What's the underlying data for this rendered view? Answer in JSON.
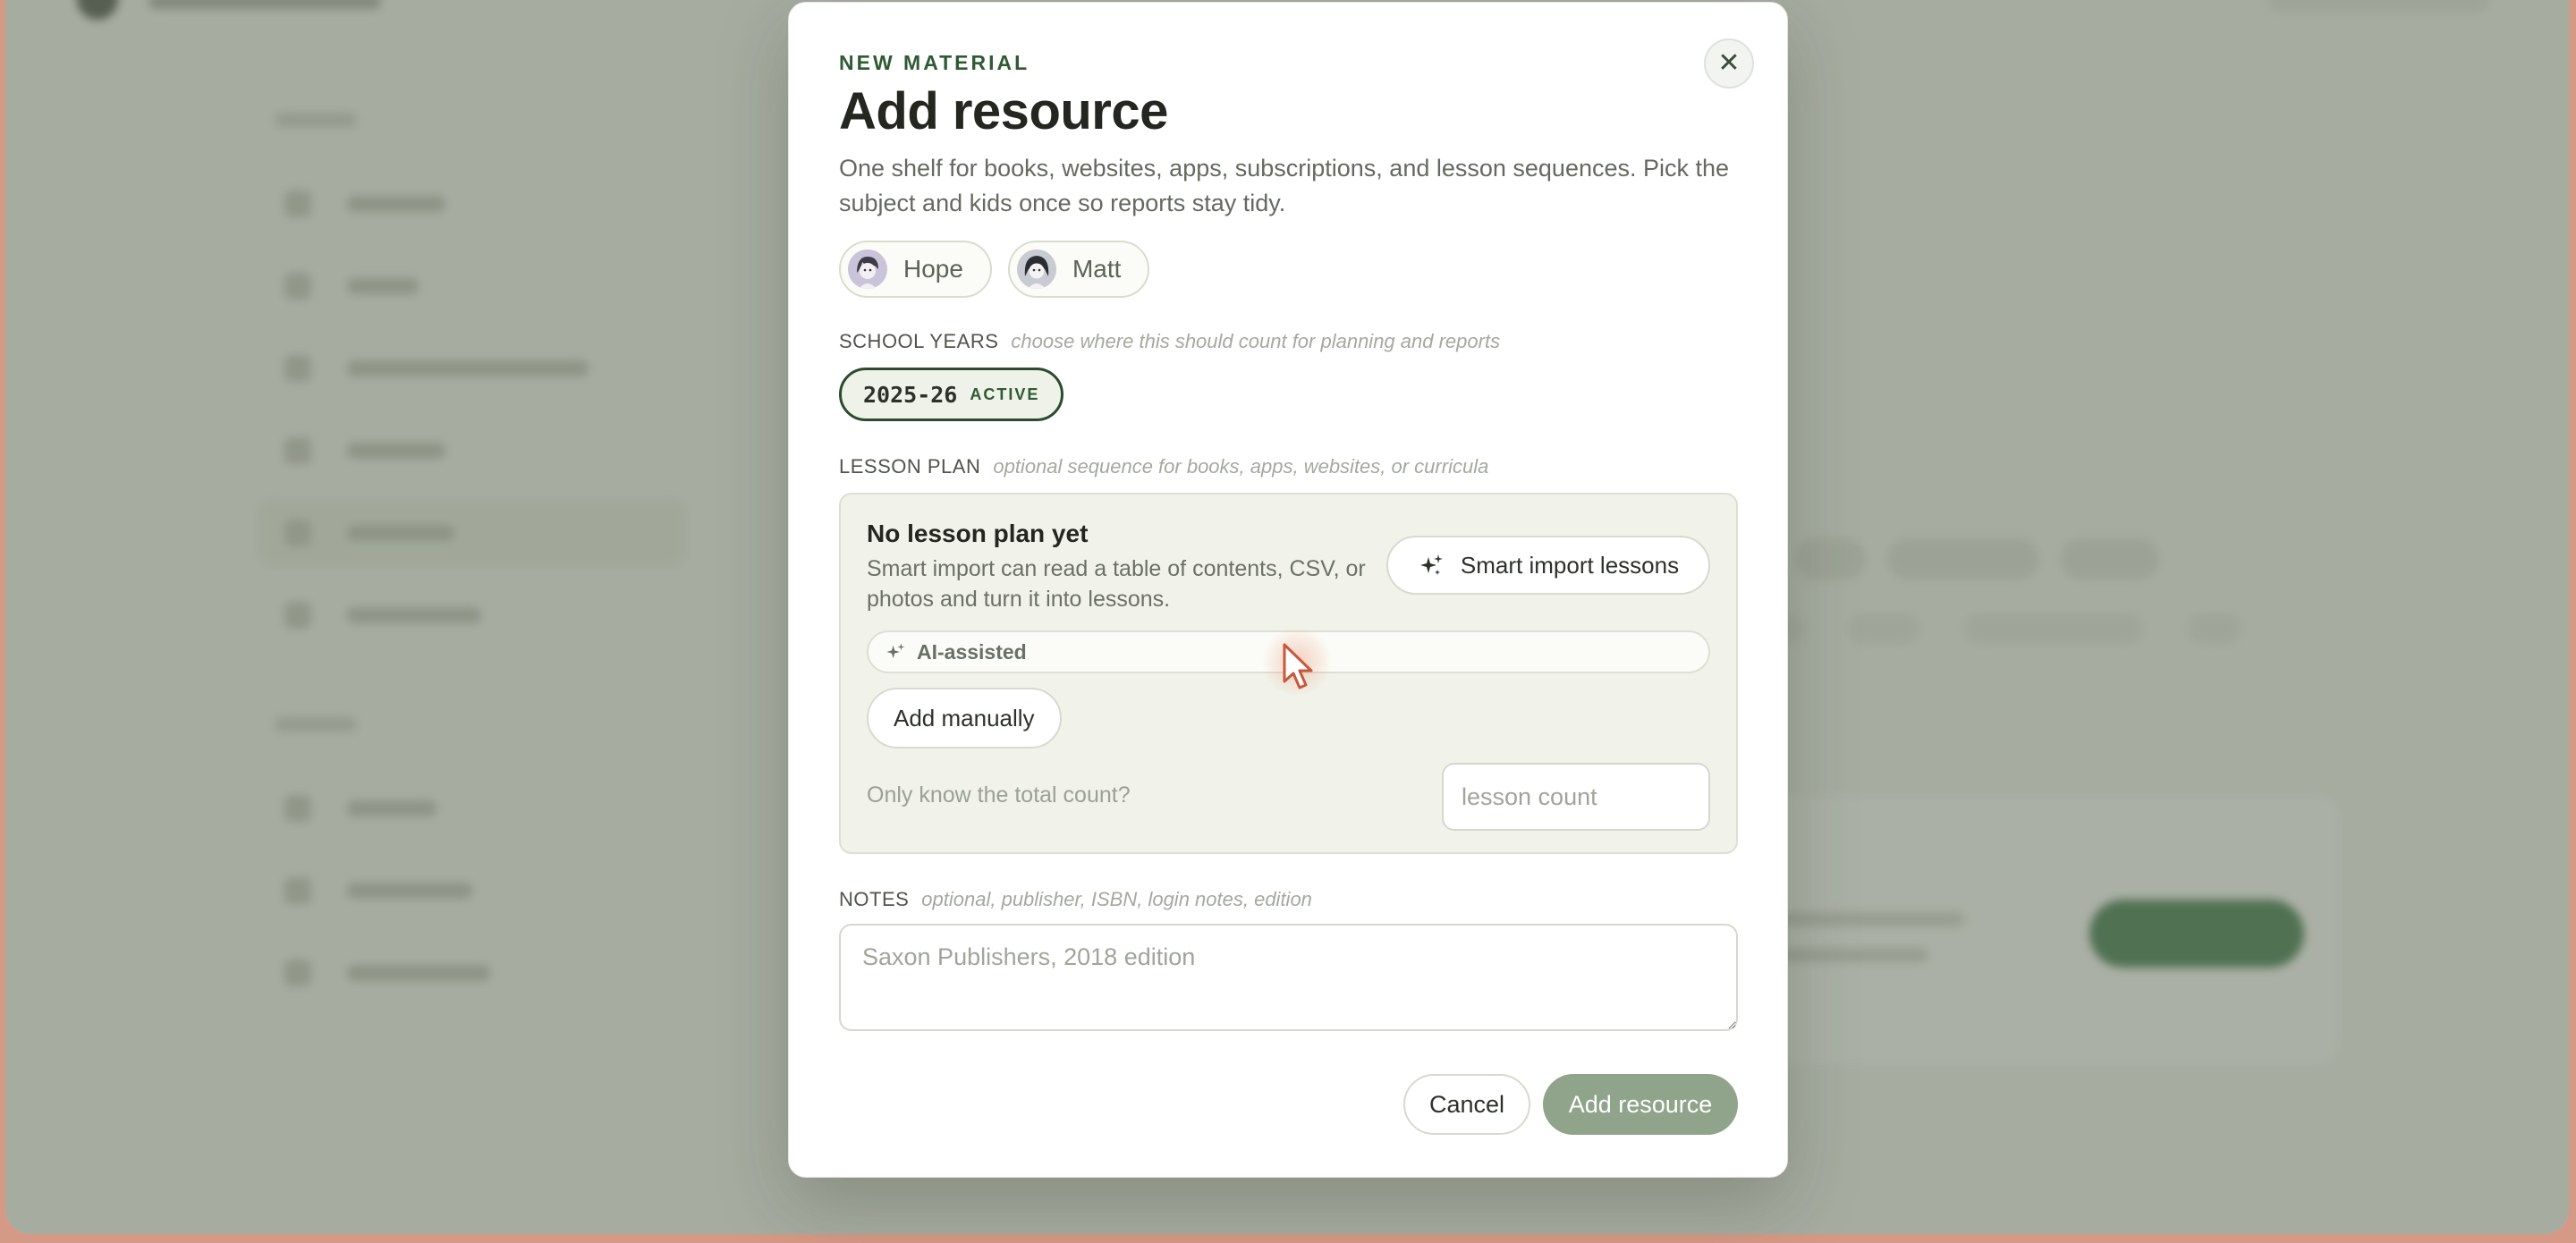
{
  "modal": {
    "eyebrow": "NEW MATERIAL",
    "title": "Add resource",
    "description": "One shelf for books, websites, apps, subscriptions, and lesson sequences. Pick the subject and kids once so reports stay tidy.",
    "close_icon": "close-icon",
    "kids": [
      {
        "name": "Hope",
        "avatar_icon": "avatar-hope"
      },
      {
        "name": "Matt",
        "avatar_icon": "avatar-matt"
      }
    ],
    "school_years": {
      "label": "SCHOOL YEARS",
      "hint": "choose where this should count for planning and reports",
      "chips": [
        {
          "year": "2025-26",
          "status": "ACTIVE",
          "selected": true
        }
      ]
    },
    "lesson_plan": {
      "label": "LESSON PLAN",
      "hint": "optional sequence for books, apps, websites, or curricula",
      "empty_title": "No lesson plan yet",
      "empty_desc": "Smart import can read a table of contents, CSV, or photos and turn it into lessons.",
      "smart_import_label": "Smart import lessons",
      "ai_badge": "AI-assisted",
      "add_manually_label": "Add manually",
      "count_prompt": "Only know the total count?",
      "count_placeholder": "lesson count",
      "count_value": ""
    },
    "notes": {
      "label": "NOTES",
      "hint": "optional, publisher, ISBN, login notes, edition",
      "placeholder": "Saxon Publishers, 2018 edition",
      "value": ""
    },
    "actions": {
      "cancel_label": "Cancel",
      "submit_label": "Add resource"
    }
  },
  "colors": {
    "accent": "#2f5a33",
    "submit_disabled": "#8fa48a",
    "scrim": "#707868",
    "panel": "#f1f3ea"
  }
}
